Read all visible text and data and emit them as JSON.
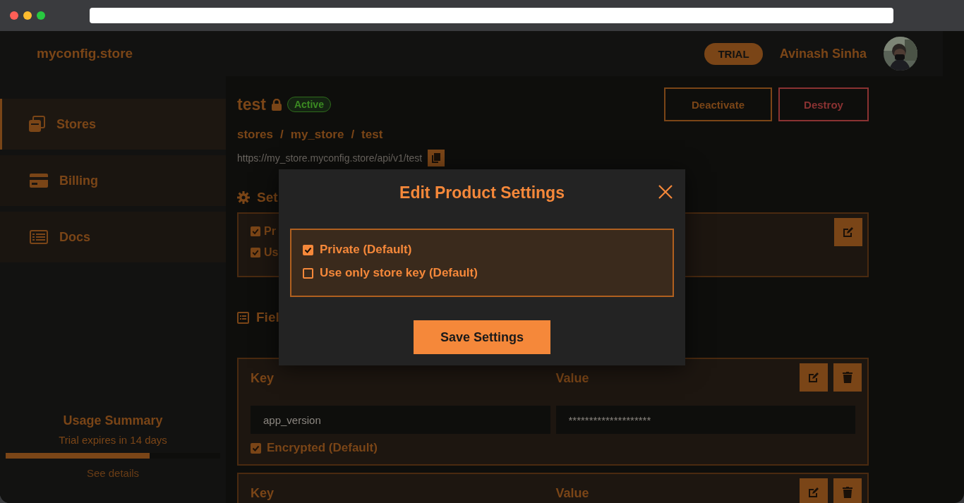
{
  "header": {
    "logo": "myconfig.store",
    "plan_badge": "TRIAL",
    "user_name": "Avinash Sinha"
  },
  "sidebar": {
    "items": [
      {
        "label": "Stores",
        "selected": true
      },
      {
        "label": "Billing",
        "selected": false
      },
      {
        "label": "Docs",
        "selected": false
      }
    ],
    "usage": {
      "title": "Usage Summary",
      "subtitle": "Trial expires in 14 days",
      "level": 0.67,
      "link": "See details"
    }
  },
  "product": {
    "name": "test",
    "locked": true,
    "status": "Active",
    "actions": [
      {
        "label": "Deactivate",
        "kind": "neutral"
      },
      {
        "label": "Destroy",
        "kind": "danger"
      }
    ],
    "breadcrumb": [
      "stores",
      "my_store",
      "test"
    ],
    "separator": "/",
    "url": "https://my_store.myconfig.store/api/v1/test"
  },
  "settings_section": {
    "title": "Set",
    "options": [
      {
        "label": "Pr",
        "checked": true
      },
      {
        "label": "Us",
        "checked": true
      }
    ]
  },
  "fields_section": {
    "title": "Fiel"
  },
  "fields": [
    {
      "key_label": "Key",
      "value_label": "Value",
      "key": "app_version",
      "value": "********************",
      "encrypted_label": "Encrypted (Default)",
      "encrypted": true
    },
    {
      "key_label": "Key",
      "value_label": "Value"
    }
  ],
  "modal": {
    "title": "Edit Product Settings",
    "options": [
      {
        "label": "Private (Default)",
        "checked": true
      },
      {
        "label": "Use only store key (Default)",
        "checked": false
      }
    ],
    "button": "Save Settings"
  }
}
